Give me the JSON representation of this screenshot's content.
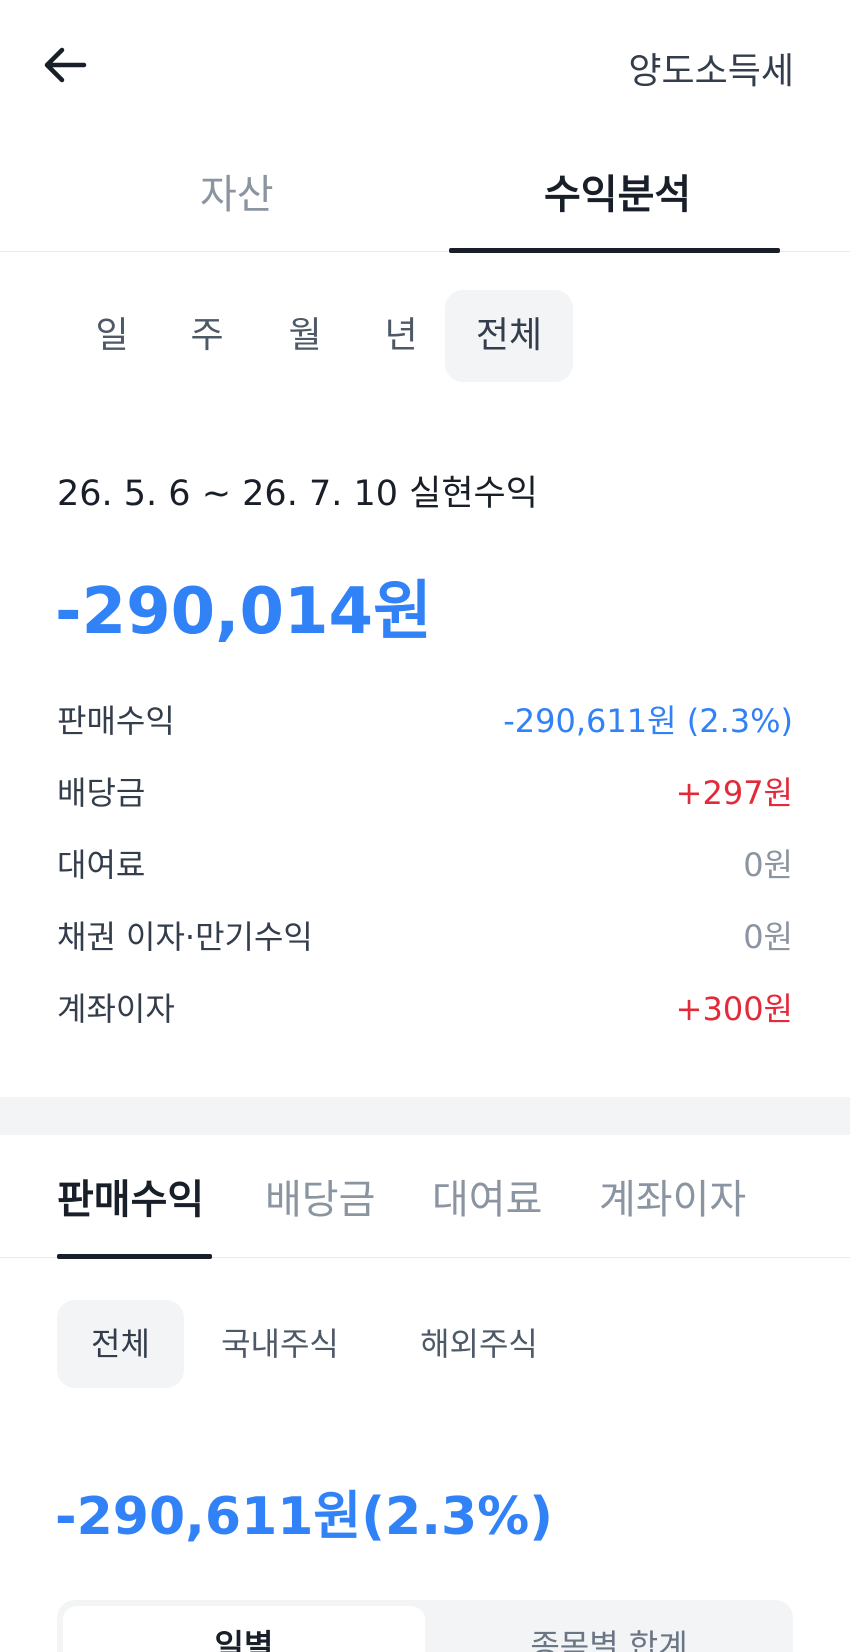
{
  "header": {
    "back_icon": "arrow-left-icon",
    "action_label": "양도소득세"
  },
  "main_tabs": [
    "자산",
    "수익분석"
  ],
  "period_filters": [
    "일",
    "주",
    "월",
    "년",
    "전체"
  ],
  "summary": {
    "range_label": "26. 5. 6 ~ 26. 7. 10 실현수익",
    "total_amount": "-290,014원"
  },
  "breakdown": [
    {
      "label": "판매수익",
      "value": "-290,611원 (2.3%)",
      "tone": "blue"
    },
    {
      "label": "배당금",
      "value": "+297원",
      "tone": "red"
    },
    {
      "label": "대여료",
      "value": "0원",
      "tone": "gray"
    },
    {
      "label": "채권 이자·만기수익",
      "value": "0원",
      "tone": "gray"
    },
    {
      "label": "계좌이자",
      "value": "+300원",
      "tone": "red"
    }
  ],
  "sub_tabs": [
    "판매수익",
    "배당금",
    "대여료",
    "계좌이자"
  ],
  "market_filters": [
    "전체",
    "국내주식",
    "해외주식"
  ],
  "sub_amount": "-290,611원(2.3%)",
  "view_toggle": [
    "일별",
    "종목별 합계"
  ],
  "colors": {
    "blue": "#3182f6",
    "red": "#e42939",
    "gray": "#8b95a1",
    "dark": "#191f28"
  }
}
